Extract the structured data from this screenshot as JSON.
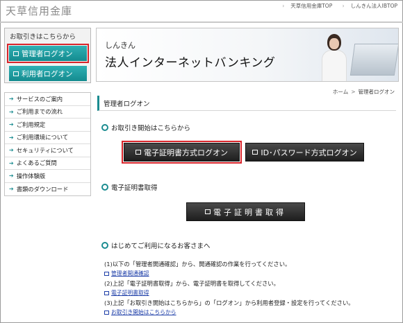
{
  "header": {
    "logo": "天草信用金庫",
    "links": [
      "天草信用金庫TOP",
      "しんきん法人IBTOP"
    ]
  },
  "login_box": {
    "title": "お取引きはこちらから",
    "admin_button": "管理者ログオン",
    "user_button": "利用者ログオン"
  },
  "nav": {
    "items": [
      "サービスのご案内",
      "ご利用までの流れ",
      "ご利用規定",
      "ご利用環境について",
      "セキュリティについて",
      "よくあるご質問",
      "操作体験版",
      "書類のダウンロード"
    ]
  },
  "banner": {
    "small": "しんきん",
    "big": "法人インターネットバンキング"
  },
  "breadcrumb": {
    "home": "ホーム",
    "current": "管理者ログオン"
  },
  "page_title": "管理者ログオン",
  "section1": {
    "title": "お取引き開始はこちらから",
    "cert_button": "電子証明書方式ログオン",
    "idpw_button": "ID･パスワード方式ログオン"
  },
  "section2": {
    "title": "電子証明書取得",
    "button": "電子証明書取得"
  },
  "section3": {
    "title": "はじめてご利用になるお客さまへ",
    "step1": "(1)以下の「管理者開通確認」から、開通確認の作業を行ってください。",
    "link1": "管理者開通確認",
    "step2": "(2)上記「電子証明書取得」から、電子証明書を取得してください。",
    "link2": "電子証明書取得",
    "step3": "(3)上記「お取引き開始はこちらから」の「ログオン」から利用者登録・設定を行ってください。",
    "link3": "お取引き開始はこちらから"
  },
  "colors": {
    "accent_teal": "#1a8c90",
    "highlight_red": "#d8242a",
    "dark_button": "#2a2a2a",
    "link_blue": "#1d3ea8"
  }
}
